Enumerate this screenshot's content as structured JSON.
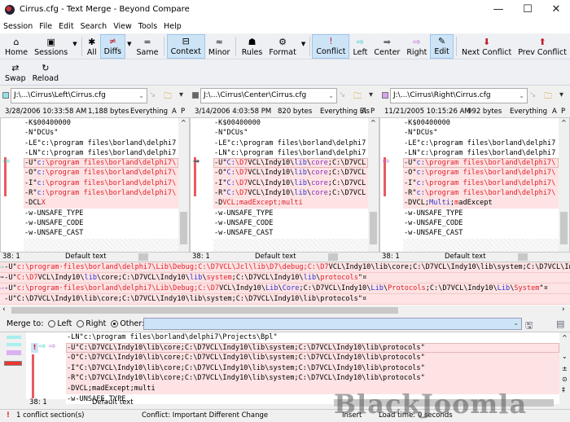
{
  "window": {
    "title": "Cirrus.cfg - Text Merge - Beyond Compare",
    "min": "—",
    "max": "☐",
    "close": "✕"
  },
  "menu": [
    "Session",
    "File",
    "Edit",
    "Search",
    "View",
    "Tools",
    "Help"
  ],
  "toolbar1": [
    {
      "label": "Home",
      "icon": "⌂",
      "name": "home"
    },
    {
      "label": "Sessions",
      "icon": "▣",
      "name": "sessions",
      "dd": true
    },
    {
      "sep": true
    },
    {
      "label": "All",
      "icon": "✱",
      "name": "all"
    },
    {
      "label": "Diffs",
      "icon": "≠",
      "name": "diffs",
      "on": true,
      "dd": true
    },
    {
      "label": "Same",
      "icon": "=",
      "name": "same"
    },
    {
      "sep": true
    },
    {
      "label": "Context",
      "icon": "⊟",
      "name": "context",
      "on": true
    },
    {
      "label": "Minor",
      "icon": "≈",
      "name": "minor"
    },
    {
      "sep": true
    },
    {
      "label": "Rules",
      "icon": "☗",
      "name": "rules"
    },
    {
      "label": "Format",
      "icon": "⚙",
      "name": "format",
      "dd": true
    },
    {
      "sep": true
    },
    {
      "label": "Conflict",
      "icon": "!",
      "name": "conflict",
      "on": true
    },
    {
      "label": "Left",
      "icon": "⇨",
      "name": "left"
    },
    {
      "label": "Center",
      "icon": "➡",
      "name": "center"
    },
    {
      "label": "Right",
      "icon": "⇨",
      "name": "right"
    },
    {
      "label": "Edit",
      "icon": "✎",
      "name": "edit",
      "on": true
    },
    {
      "sep": true
    },
    {
      "label": "Next Conflict",
      "icon": "⬇",
      "name": "next-conflict"
    },
    {
      "label": "Prev Conflict",
      "icon": "⬆",
      "name": "prev-conflict"
    }
  ],
  "toolbar2": [
    {
      "label": "Swap",
      "icon": "⇄",
      "name": "swap"
    },
    {
      "label": "Reload",
      "icon": "↻",
      "name": "reload"
    }
  ],
  "colors": {
    "left": "#8fe3e8",
    "center": "#666666",
    "right": "#d9a0f0",
    "diff_bg": "#fde3e3",
    "red": "#e0202c"
  },
  "panes": [
    {
      "path": "J:\\...\\Cirrus\\Left\\Cirrus.cfg",
      "date": "3/28/2006 10:33:58 AM",
      "size": "1,188 bytes",
      "filter": "Everything",
      "a": "A",
      "p": "P",
      "pos": "38: 1",
      "mode": "Default text",
      "lines": [
        {
          "s": [
            [
              "-K$00400000",
              ""
            ]
          ]
        },
        {
          "s": [
            [
              "-N\"DCUs\"",
              ""
            ]
          ]
        },
        {
          "s": [
            [
              "-LE\"c:\\program files\\borland\\delphi7",
              ""
            ]
          ]
        },
        {
          "s": [
            [
              "-LN\"c:\\program files\\borland\\delphi7",
              ""
            ]
          ]
        },
        {
          "d": 1,
          "cur": 1,
          "s": [
            [
              "-U\"",
              ""
            ],
            [
              "c:",
              "b"
            ],
            [
              "\\program files\\borland\\delphi7\\",
              "r"
            ]
          ]
        },
        {
          "d": 1,
          "s": [
            [
              "-O\"",
              ""
            ],
            [
              "c:",
              "b"
            ],
            [
              "\\program files\\borland\\delphi7\\",
              "r"
            ]
          ]
        },
        {
          "d": 1,
          "s": [
            [
              "-I\"",
              ""
            ],
            [
              "c:",
              "b"
            ],
            [
              "\\program files\\borland\\delphi7\\",
              "r"
            ]
          ]
        },
        {
          "d": 1,
          "s": [
            [
              "-R\"",
              ""
            ],
            [
              "c:",
              "b"
            ],
            [
              "\\program files\\borland\\delphi7\\",
              "r"
            ]
          ]
        },
        {
          "d": 1,
          "s": [
            [
              "-DCL",
              ""
            ],
            [
              "X",
              "r"
            ]
          ]
        },
        {
          "s": [
            [
              "-w-UNSAFE_TYPE",
              ""
            ]
          ]
        },
        {
          "s": [
            [
              "-w-UNSAFE_CODE",
              ""
            ]
          ]
        },
        {
          "s": [
            [
              "-w-UNSAFE_CAST",
              ""
            ]
          ]
        }
      ]
    },
    {
      "path": "J:\\...\\Cirrus\\Center\\Cirrus.cfg",
      "date": "3/14/2006 4:03:58 PM",
      "size": "820 bytes",
      "filter": "Everything Els",
      "a": "A",
      "p": "P",
      "pos": "38: 1",
      "mode": "Default text",
      "lines": [
        {
          "s": [
            [
              "-K$00400000",
              ""
            ]
          ]
        },
        {
          "s": [
            [
              "-N\"DCUs\"",
              ""
            ]
          ]
        },
        {
          "s": [
            [
              "-LE\"c:\\program files\\borland\\delphi7",
              ""
            ]
          ]
        },
        {
          "s": [
            [
              "-LN\"c:\\program files\\borland\\delphi7",
              ""
            ]
          ]
        },
        {
          "d": 1,
          "cur": 1,
          "s": [
            [
              "-U\"",
              ""
            ],
            [
              "C:",
              "b"
            ],
            [
              "\\D7",
              "r"
            ],
            [
              "VCL\\Indy10\\",
              ""
            ],
            [
              "lib",
              "b"
            ],
            [
              "\\",
              ""
            ],
            [
              "core",
              "p"
            ],
            [
              ";C:\\D7VCL",
              ""
            ]
          ]
        },
        {
          "d": 1,
          "s": [
            [
              "-O\"",
              ""
            ],
            [
              "C:",
              "b"
            ],
            [
              "\\D7",
              "r"
            ],
            [
              "VCL\\Indy10\\",
              ""
            ],
            [
              "lib",
              "b"
            ],
            [
              "\\",
              ""
            ],
            [
              "core",
              "p"
            ],
            [
              ";C:\\D7VCL",
              ""
            ]
          ]
        },
        {
          "d": 1,
          "s": [
            [
              "-I\"",
              ""
            ],
            [
              "C:",
              "b"
            ],
            [
              "\\D7",
              "r"
            ],
            [
              "VCL\\Indy10\\",
              ""
            ],
            [
              "lib",
              "b"
            ],
            [
              "\\",
              ""
            ],
            [
              "core",
              "p"
            ],
            [
              ";C:\\D7VCL",
              ""
            ]
          ]
        },
        {
          "d": 1,
          "s": [
            [
              "-R\"",
              ""
            ],
            [
              "C:",
              "b"
            ],
            [
              "\\D7",
              "r"
            ],
            [
              "VCL\\Indy10\\",
              ""
            ],
            [
              "lib",
              "b"
            ],
            [
              "\\",
              ""
            ],
            [
              "core",
              "p"
            ],
            [
              ";C:\\D7VCL",
              ""
            ]
          ]
        },
        {
          "d": 1,
          "s": [
            [
              "-D",
              ""
            ],
            [
              "VCL;madExcept;multi",
              "r"
            ]
          ]
        },
        {
          "s": [
            [
              "-w-UNSAFE_TYPE",
              ""
            ]
          ]
        },
        {
          "s": [
            [
              "-w-UNSAFE_CODE",
              ""
            ]
          ]
        },
        {
          "s": [
            [
              "-w-UNSAFE_CAST",
              ""
            ]
          ]
        }
      ]
    },
    {
      "path": "J:\\...\\Cirrus\\Right\\Cirrus.cfg",
      "date": "11/21/2005 10:15:26 AM",
      "size": "992 bytes",
      "filter": "Everything",
      "a": "A",
      "p": "P",
      "pos": "38: 1",
      "mode": "Default text",
      "lines": [
        {
          "s": [
            [
              "-K$00400000",
              ""
            ]
          ]
        },
        {
          "s": [
            [
              "-N\"DCUs\"",
              ""
            ]
          ]
        },
        {
          "s": [
            [
              "-LE\"c:\\program files\\borland\\delphi7",
              ""
            ]
          ]
        },
        {
          "s": [
            [
              "-LN\"c:\\program files\\borland\\delphi7",
              ""
            ]
          ]
        },
        {
          "d": 1,
          "cur": 1,
          "s": [
            [
              "-U\"",
              ""
            ],
            [
              "c:",
              "b"
            ],
            [
              "\\program files\\borland\\delphi7\\",
              "r"
            ]
          ]
        },
        {
          "d": 1,
          "s": [
            [
              "-O\"",
              ""
            ],
            [
              "c:",
              "b"
            ],
            [
              "\\program files\\borland\\delphi7\\",
              "r"
            ]
          ]
        },
        {
          "d": 1,
          "s": [
            [
              "-I\"",
              ""
            ],
            [
              "c:",
              "b"
            ],
            [
              "\\program files\\borland\\delphi7\\",
              "r"
            ]
          ]
        },
        {
          "d": 1,
          "s": [
            [
              "-R\"",
              ""
            ],
            [
              "c:",
              "b"
            ],
            [
              "\\program files\\borland\\delphi7\\",
              "r"
            ]
          ]
        },
        {
          "d": 1,
          "s": [
            [
              "-DVCL;",
              ""
            ],
            [
              "Multi",
              "b"
            ],
            [
              ";",
              ""
            ],
            [
              "m",
              "r"
            ],
            [
              "adExcept",
              ""
            ]
          ]
        },
        {
          "s": [
            [
              "-w-UNSAFE_TYPE",
              ""
            ]
          ]
        },
        {
          "s": [
            [
              "-w-UNSAFE_CODE",
              ""
            ]
          ]
        },
        {
          "s": [
            [
              "-w-UNSAFE_CAST",
              ""
            ]
          ]
        }
      ]
    }
  ],
  "merge_lines": [
    {
      "arrow": "⇨",
      "s": [
        [
          "-U\"",
          ""
        ],
        [
          "c:\\program·files\\borland\\delphi7\\Lib\\Debug;C:\\D7VCL\\Jcl\\lib\\D7\\debug;C:\\D7",
          "r"
        ],
        [
          "VCL\\Indy10\\lib\\core;C:\\D7VCL\\Indy10\\lib\\system;C:\\D7VCL\\Indy10\\lib\\protocols\"",
          ""
        ]
      ]
    },
    {
      "arrow": "➡",
      "s": [
        [
          "-U\"",
          ""
        ],
        [
          "C:\\D7",
          "r"
        ],
        [
          "VCL\\Indy10\\",
          ""
        ],
        [
          "lib",
          "b"
        ],
        [
          "\\core;C:\\D7VCL\\Indy10\\",
          ""
        ],
        [
          "lib",
          "b"
        ],
        [
          "\\",
          ""
        ],
        [
          "system",
          "r"
        ],
        [
          ";C:\\D7VCL\\Indy10\\",
          ""
        ],
        [
          "lib",
          "b"
        ],
        [
          "\\",
          ""
        ],
        [
          "protocols",
          "r"
        ],
        [
          "\"¤",
          ""
        ]
      ]
    },
    {
      "arrow": "⇨",
      "s": [
        [
          "-U\"",
          ""
        ],
        [
          "c:\\program·files\\borland\\delphi7\\Lib\\Debug;C:\\D7",
          "r"
        ],
        [
          "VCL\\Indy10\\",
          ""
        ],
        [
          "Lib",
          "b"
        ],
        [
          "\\",
          ""
        ],
        [
          "Core",
          "b"
        ],
        [
          ";C:\\D7VCL\\Indy10\\",
          ""
        ],
        [
          "Lib",
          "b"
        ],
        [
          "\\",
          ""
        ],
        [
          "Protocols",
          "r"
        ],
        [
          ";C:\\D7VCL\\Indy10\\",
          ""
        ],
        [
          "Lib",
          "b"
        ],
        [
          "\\",
          ""
        ],
        [
          "System",
          "r"
        ],
        [
          "\"¤",
          ""
        ]
      ]
    },
    {
      "arrow": "",
      "s": [
        [
          "-U\"C:\\D7VCL\\Indy10\\lib\\core;C:\\D7VCL\\Indy10\\lib\\system;C:\\D7VCL\\Indy10\\lib\\protocols\"¤",
          ""
        ]
      ]
    }
  ],
  "merge_to": {
    "label": "Merge to:",
    "left": "Left",
    "right": "Right",
    "other": "Other:",
    "other_value": ""
  },
  "output": {
    "pos": "38: 1",
    "mode": "Default text",
    "lines": [
      {
        "s": [
          [
            "-LN\"c:\\program files\\borland\\delphi7\\Projects\\Bpl\"",
            ""
          ]
        ]
      },
      {
        "d": 1,
        "cur": 1,
        "s": [
          [
            "-U\"C:\\D7VCL\\Indy10\\lib\\core;C:\\D7VCL\\Indy10\\lib\\system;C:\\D7VCL\\Indy10\\lib\\protocols\"",
            ""
          ]
        ]
      },
      {
        "d": 1,
        "s": [
          [
            "-O\"C:\\D7VCL\\Indy10\\lib\\core;C:\\D7VCL\\Indy10\\lib\\system;C:\\D7VCL\\Indy10\\lib\\protocols\"",
            ""
          ]
        ]
      },
      {
        "d": 1,
        "s": [
          [
            "-I\"C:\\D7VCL\\Indy10\\lib\\core;C:\\D7VCL\\Indy10\\lib\\system;C:\\D7VCL\\Indy10\\lib\\protocols\"",
            ""
          ]
        ]
      },
      {
        "d": 1,
        "s": [
          [
            "-R\"C:\\D7VCL\\Indy10\\lib\\core;C:\\D7VCL\\Indy10\\lib\\system;C:\\D7VCL\\Indy10\\lib\\protocols\"",
            ""
          ]
        ]
      },
      {
        "d": 1,
        "s": [
          [
            "-DVCL;madExcept;multi",
            ""
          ]
        ]
      },
      {
        "s": [
          [
            "-w-UNSAFE_TYPE",
            ""
          ]
        ]
      }
    ]
  },
  "status": {
    "conflicts": "1 conflict section(s)",
    "conflict_type": "Conflict: Important Different Change",
    "mode": "Insert",
    "load": "Load time: 0 seconds"
  },
  "watermark": "BlackJoomla"
}
